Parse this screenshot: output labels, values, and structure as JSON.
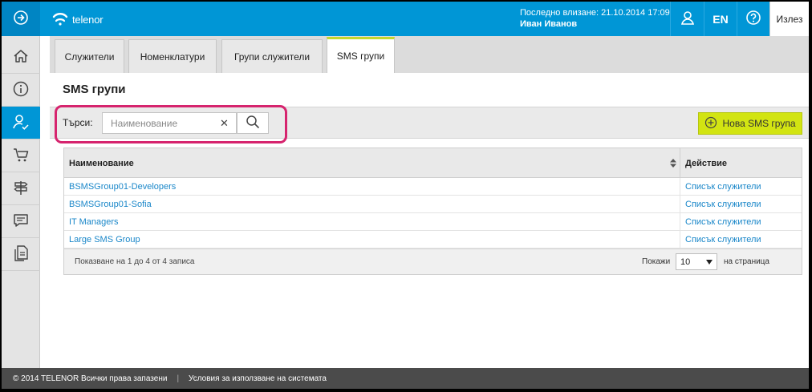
{
  "brand": {
    "name": "telenor"
  },
  "header": {
    "last_login_label": "Последно влизане: 21.10.2014 17:09",
    "user_name": "Иван Иванов",
    "lang": "EN",
    "logout": "Излез"
  },
  "sidebar": {
    "items": [
      {
        "icon": "home-icon"
      },
      {
        "icon": "info-icon"
      },
      {
        "icon": "user-check-icon",
        "active": true
      },
      {
        "icon": "cart-icon"
      },
      {
        "icon": "signpost-icon"
      },
      {
        "icon": "message-icon"
      },
      {
        "icon": "documents-icon"
      }
    ]
  },
  "tabs": [
    {
      "label": "Служители"
    },
    {
      "label": "Номенклатури"
    },
    {
      "label": "Групи служители"
    },
    {
      "label": "SMS групи",
      "active": true
    }
  ],
  "page": {
    "title": "SMS групи"
  },
  "search": {
    "label": "Търси:",
    "placeholder": "Наименование",
    "new_button": "Нова SMS група"
  },
  "table": {
    "columns": [
      "Наименование",
      "Действие"
    ],
    "rows": [
      {
        "name": "BSMSGroup01-Developers",
        "action": "Списък служители"
      },
      {
        "name": "BSMSGroup01-Sofia",
        "action": "Списък служители"
      },
      {
        "name": "IT Managers",
        "action": "Списък служители"
      },
      {
        "name": "Large SMS Group",
        "action": "Списък служители"
      }
    ],
    "info": "Показване на 1 до 4 от 4 записа",
    "show_label": "Покажи",
    "per_page_value": "10",
    "per_page_suffix": "на страница"
  },
  "footer": {
    "copyright": "© 2014 TELENOR Всички права запазени",
    "terms": "Условия за използване на системата"
  },
  "colors": {
    "primary": "#0096d6",
    "accent": "#d2e412",
    "highlight": "#d6246e",
    "link": "#1a87c9"
  }
}
